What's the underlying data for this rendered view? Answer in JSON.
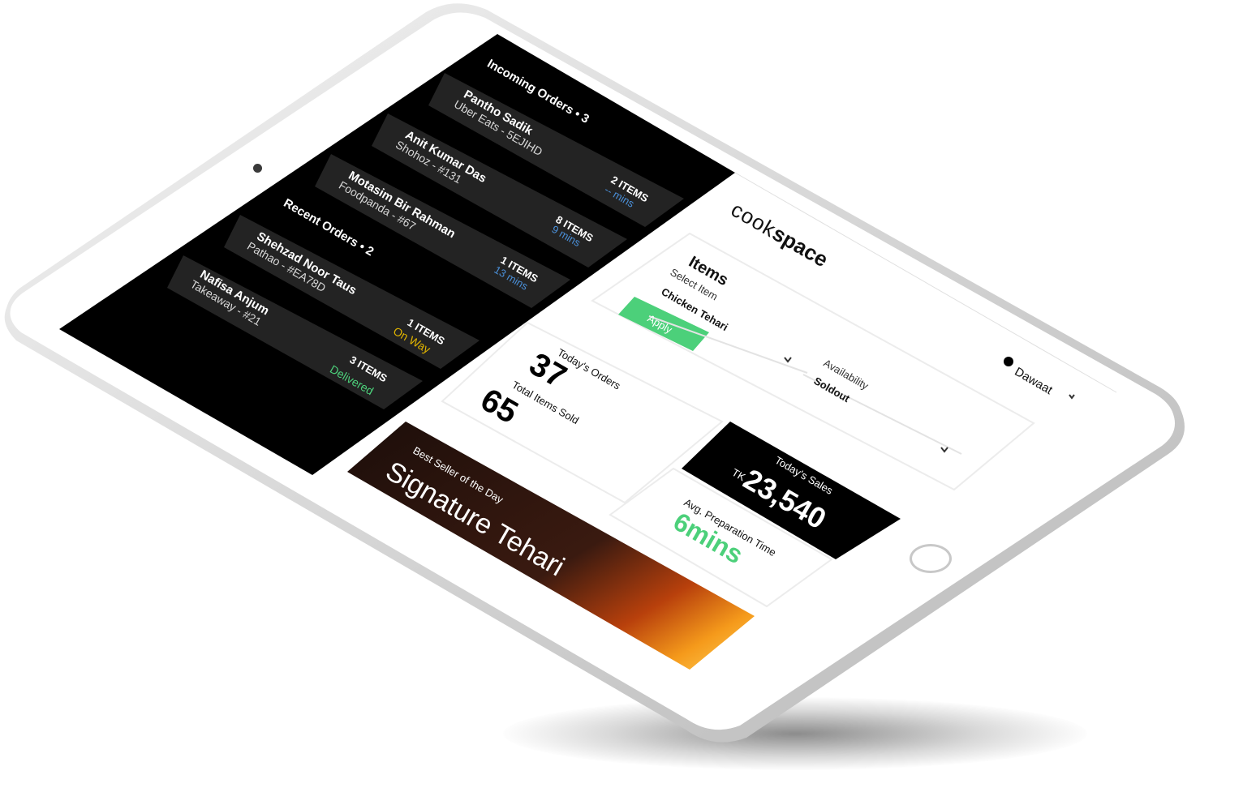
{
  "incoming": {
    "title": "Incoming Orders • 3",
    "orders": [
      {
        "name": "Pantho Sadik",
        "sub": "Uber Eats - 5EJIHD",
        "items": "2 ITEMS",
        "status": "-- mins"
      },
      {
        "name": "Anit Kumar Das",
        "sub": "Shohoz - #131",
        "items": "8 ITEMS",
        "status": "9 mins"
      },
      {
        "name": "Motasim Bir Rahman",
        "sub": "Foodpanda - #67",
        "items": "1 ITEMS",
        "status": "13 mins"
      }
    ]
  },
  "recent": {
    "title": "Recent Orders • 2",
    "orders": [
      {
        "name": "Shehzad Noor Taus",
        "sub": "Pathao - #EA78D",
        "items": "1 ITEMS",
        "status": "On Way"
      },
      {
        "name": "Nafisa Anjum",
        "sub": "Takeaway - #21",
        "items": "3 ITEMS",
        "status": "Delivered"
      }
    ]
  },
  "brand": {
    "light": "cook",
    "bold": "space"
  },
  "header": {
    "restaurant": "Dawaat"
  },
  "items_panel": {
    "title": "Items",
    "select_label": "Select Item",
    "select_value": "Chicken Tehari",
    "availability_label": "Availability",
    "availability_value": "Soldout",
    "apply_label": "Apply"
  },
  "stats": {
    "orders_label": "Today's Orders",
    "orders_value": "37",
    "sold_label": "Total Items Sold",
    "sold_value": "65"
  },
  "sales": {
    "label": "Today's Sales",
    "currency": "TK",
    "value": "23,540"
  },
  "prep": {
    "label": "Avg. Preparation Time",
    "value": "6mins"
  },
  "best": {
    "label": "Best Seller of the Day",
    "value": "Signature Tehari"
  },
  "colors": {
    "green": "#4cd07a",
    "blue": "#4a8fd8",
    "yellow": "#e0b400",
    "dark_card": "#232323"
  },
  "icons": [
    "chevron-down-icon",
    "status-dot-icon"
  ]
}
